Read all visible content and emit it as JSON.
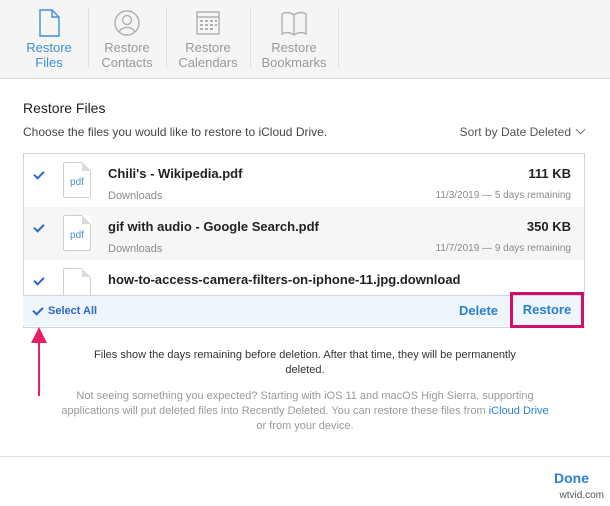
{
  "tabs": [
    {
      "line1": "Restore",
      "line2": "Files",
      "icon": "document-icon",
      "active": true
    },
    {
      "line1": "Restore",
      "line2": "Contacts",
      "icon": "contact-icon",
      "active": false
    },
    {
      "line1": "Restore",
      "line2": "Calendars",
      "icon": "calendar-icon",
      "active": false
    },
    {
      "line1": "Restore",
      "line2": "Bookmarks",
      "icon": "book-icon",
      "active": false
    }
  ],
  "section": {
    "title": "Restore Files",
    "subtitle": "Choose the files you would like to restore to iCloud Drive.",
    "sort_label": "Sort by Date Deleted"
  },
  "files": [
    {
      "name": "Chili's - Wikipedia.pdf",
      "ext": "pdf",
      "size": "111 KB",
      "location": "Downloads",
      "deleted": "11/3/2019 — 5 days remaining",
      "checked": true
    },
    {
      "name": "gif with audio - Google Search.pdf",
      "ext": "pdf",
      "size": "350 KB",
      "location": "Downloads",
      "deleted": "11/7/2019 — 9 days remaining",
      "checked": true
    },
    {
      "name": "how-to-access-camera-filters-on-iphone-11.jpg.download",
      "ext": "",
      "size": "",
      "location": "",
      "deleted": "",
      "checked": true
    }
  ],
  "footer": {
    "select_all": "Select All",
    "delete": "Delete",
    "restore": "Restore"
  },
  "notes": {
    "line1": "Files show the days remaining before deletion. After that time, they will be permanently deleted.",
    "line2_pre": "Not seeing something you expected? Starting with iOS 11 and macOS High Sierra, supporting applications will put deleted files into Recently Deleted. You can restore these files from ",
    "line2_link": "iCloud Drive",
    "line2_post": " or from your device."
  },
  "done": "Done",
  "watermark": "wtvid.com",
  "colors": {
    "accent": "#2a7fd0",
    "highlight": "#d10f6b",
    "arrow": "#e81e6b"
  }
}
